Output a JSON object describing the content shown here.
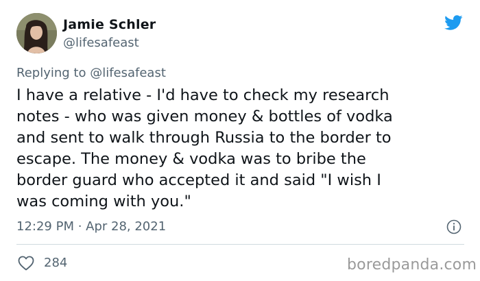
{
  "author": {
    "name": "Jamie Schler",
    "handle": "@lifesafeast"
  },
  "reply_prefix": "Replying to ",
  "reply_to": "@lifesafeast",
  "body_lines": [
    "I have a relative - I'd have to check my research",
    "notes - who was given money & bottles of vodka",
    "and sent to walk through Russia to the border to",
    "escape. The money & vodka was to bribe the",
    "border guard who accepted it and said \"I wish I",
    "was coming with you.\""
  ],
  "timestamp": "12:29 PM · Apr 28, 2021",
  "likes": "284",
  "watermark": "boredpanda.com",
  "icons": {
    "brand": "twitter-bird-icon",
    "info": "info-icon",
    "like": "heart-icon"
  },
  "colors": {
    "twitter_blue": "#1d9bf0",
    "text": "#0f1419",
    "secondary": "#536471",
    "divider": "#cfd9de"
  }
}
